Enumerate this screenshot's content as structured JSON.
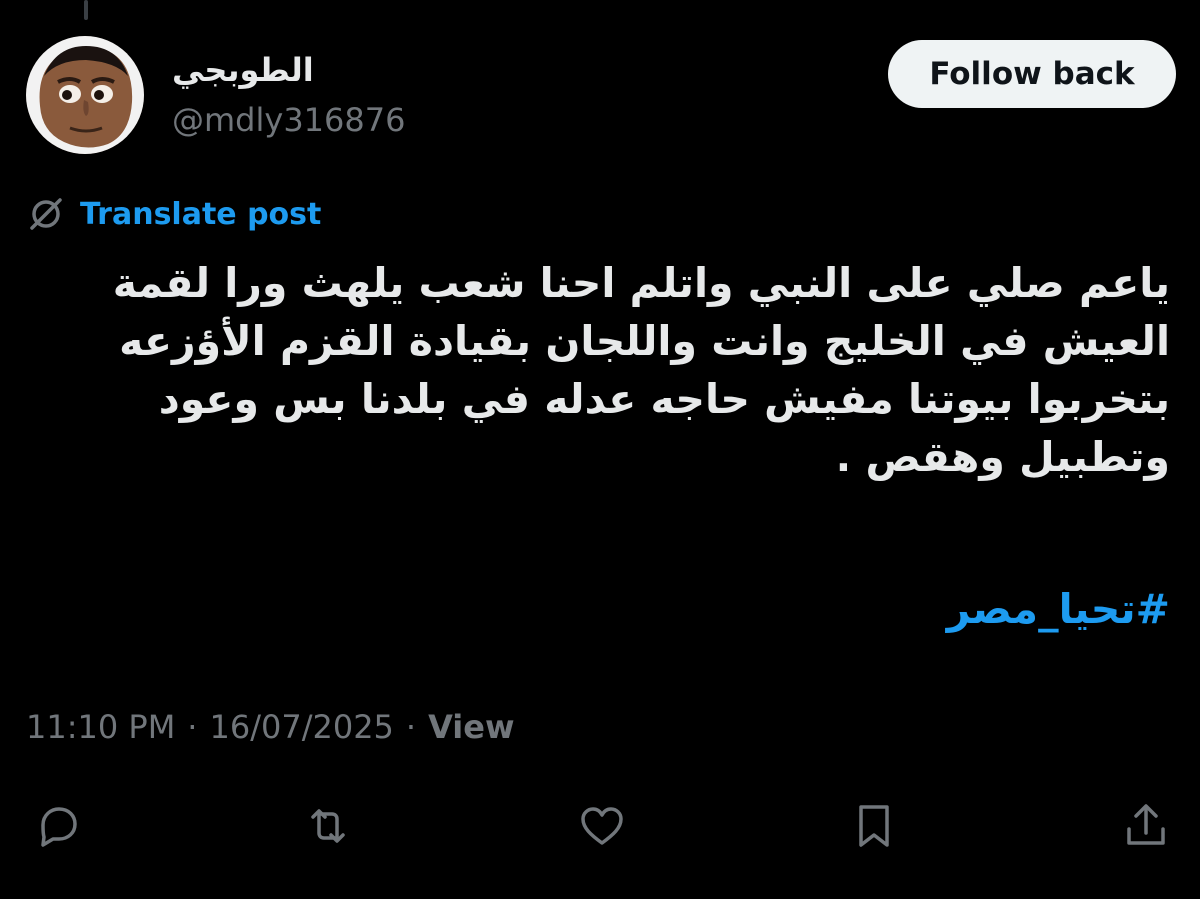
{
  "author": {
    "display_name": "الطوبجي",
    "handle": "@mdly316876"
  },
  "follow_button_label": "Follow back",
  "translate_label": "Translate post",
  "tweet": {
    "lines": [
      "ياعم صلي على النبي واتلم احنا شعب يلهث ورا لقمة",
      "العيش في الخليج وانت واللجان بقيادة القزم الأؤزعه",
      "بتخربوا بيوتنا مفيش حاجه عدله في بلدنا بس وعود",
      "وتطبيل وهقص ."
    ],
    "hashtag": "#تحيا_مصر"
  },
  "meta": {
    "time": "11:10 PM",
    "separator": "·",
    "date": "16/07/2025",
    "view_label": "View"
  },
  "actions": [
    {
      "icon": "reply-icon"
    },
    {
      "icon": "retweet-icon"
    },
    {
      "icon": "like-icon"
    },
    {
      "icon": "bookmark-icon"
    },
    {
      "icon": "share-icon"
    }
  ],
  "colors": {
    "background": "#000000",
    "text": "#e7e9ea",
    "muted": "#71767b",
    "accent": "#1d9bf0",
    "button_bg": "#eff3f4"
  }
}
